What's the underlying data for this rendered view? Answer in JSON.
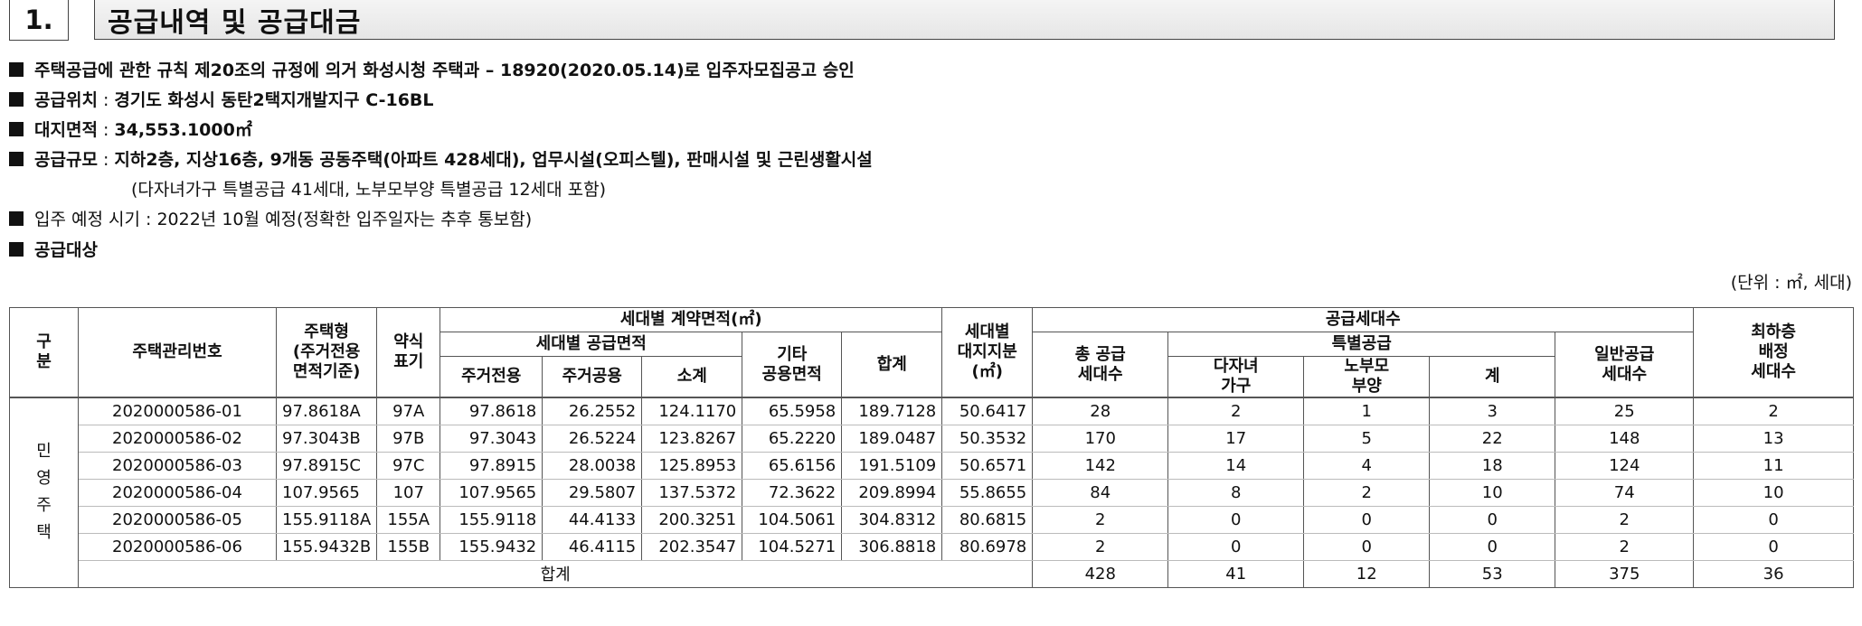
{
  "header": {
    "number": "1.",
    "title": "공급내역 및 공급대금"
  },
  "info": {
    "line1": "주택공급에 관한 규칙 제20조의 규정에 의거 화성시청 주택과 – 18920(2020.05.14)로 입주자모집공고 승인",
    "line2_label": "공급위치",
    "line2_value": "경기도 화성시 동탄2택지개발지구 C-16BL",
    "line3_label": "대지면적",
    "line3_value": "34,553.1000㎡",
    "line4_label": "공급규모",
    "line4_value": "지하2층, 지상16층, 9개동 공동주택(아파트 428세대), 업무시설(오피스텔), 판매시설 및 근린생활시설",
    "line4_sub": "(다자녀가구 특별공급 41세대, 노부모부양 특별공급 12세대 포함)",
    "line5": "입주 예정 시기 : 2022년 10월 예정(정확한 입주일자는 추후 통보함)",
    "line6": "공급대상",
    "sep": ":",
    "unit": "(단위 : ㎡, 세대)"
  },
  "table": {
    "headers": {
      "gubun": "구\n분",
      "mgmt_no": "주택관리번호",
      "type": "주택형\n(주거전용\n면적기준)",
      "abbr": "약식\n표기",
      "contract_area": "세대별 계약면적(㎡)",
      "supply_area": "세대별 공급면적",
      "exclusive": "주거전용",
      "common": "주거공용",
      "subtotal": "소계",
      "other_common": "기타\n공용면적",
      "sum": "합계",
      "land_share": "세대별\n대지지분\n(㎡)",
      "supply_units": "공급세대수",
      "total_supply": "총 공급\n세대수",
      "special": "특별공급",
      "multi_child": "다자녀\n가구",
      "elderly": "노부모\n부양",
      "special_total": "계",
      "general": "일반공급\n세대수",
      "lowest_floor": "최하층\n배정\n세대수"
    },
    "category": "민\n영\n주\n택",
    "rows": [
      [
        "2020000586-01",
        "97.8618A",
        "97A",
        "97.8618",
        "26.2552",
        "124.1170",
        "65.5958",
        "189.7128",
        "50.6417",
        "28",
        "2",
        "1",
        "3",
        "25",
        "2"
      ],
      [
        "2020000586-02",
        "97.3043B",
        "97B",
        "97.3043",
        "26.5224",
        "123.8267",
        "65.2220",
        "189.0487",
        "50.3532",
        "170",
        "17",
        "5",
        "22",
        "148",
        "13"
      ],
      [
        "2020000586-03",
        "97.8915C",
        "97C",
        "97.8915",
        "28.0038",
        "125.8953",
        "65.6156",
        "191.5109",
        "50.6571",
        "142",
        "14",
        "4",
        "18",
        "124",
        "11"
      ],
      [
        "2020000586-04",
        "107.9565",
        "107",
        "107.9565",
        "29.5807",
        "137.5372",
        "72.3622",
        "209.8994",
        "55.8655",
        "84",
        "8",
        "2",
        "10",
        "74",
        "10"
      ],
      [
        "2020000586-05",
        "155.9118A",
        "155A",
        "155.9118",
        "44.4133",
        "200.3251",
        "104.5061",
        "304.8312",
        "80.6815",
        "2",
        "0",
        "0",
        "0",
        "2",
        "0"
      ],
      [
        "2020000586-06",
        "155.9432B",
        "155B",
        "155.9432",
        "46.4115",
        "202.3547",
        "104.5271",
        "306.8818",
        "80.6978",
        "2",
        "0",
        "0",
        "0",
        "2",
        "0"
      ]
    ],
    "total": {
      "label": "합계",
      "values": [
        "428",
        "41",
        "12",
        "53",
        "375",
        "36"
      ]
    }
  }
}
